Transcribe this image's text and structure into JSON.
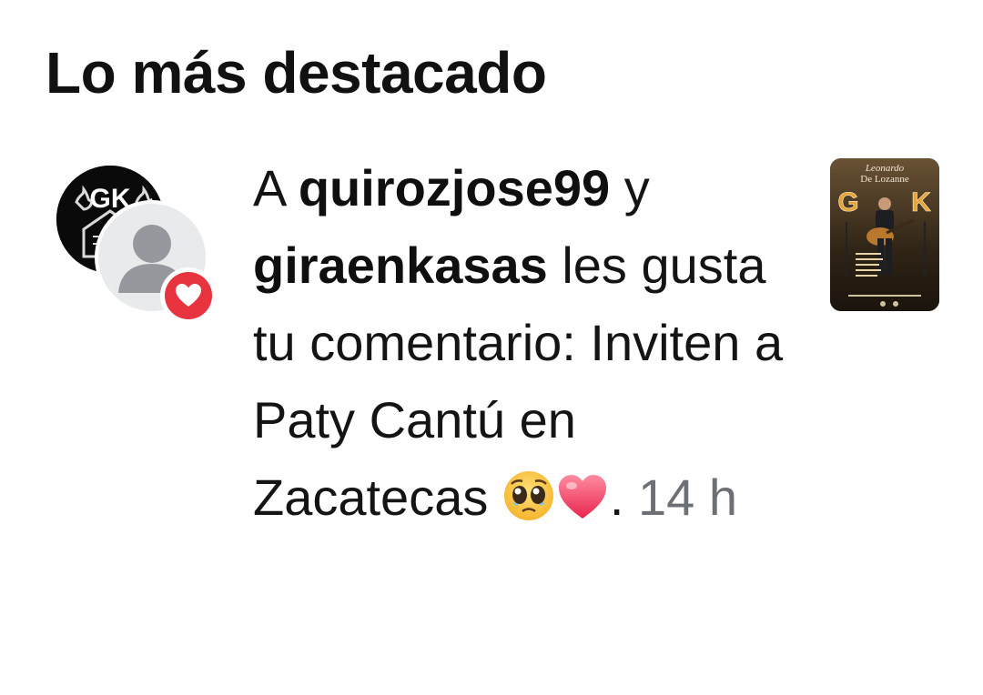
{
  "section": {
    "title": "Lo más destacado"
  },
  "notification": {
    "prefix": "A",
    "user1": "quirozjose99",
    "connector": "y",
    "user2": "giraenkasas",
    "verb": "les gusta tu comentario:",
    "comment": "Inviten a Paty Cantú en Zacatecas",
    "emojis": [
      "pleading-face-emoji",
      "red-heart-emoji"
    ],
    "separator": ".",
    "time": "14 h",
    "avatar_primary_logo": "GK",
    "badge_icon": "heart-icon",
    "badge_color": "#e8343f"
  },
  "thumbnail": {
    "title_line1": "Leonardo",
    "title_line2": "De Lozanne",
    "marquee": "GK",
    "icon": "guitar-poster-image"
  }
}
